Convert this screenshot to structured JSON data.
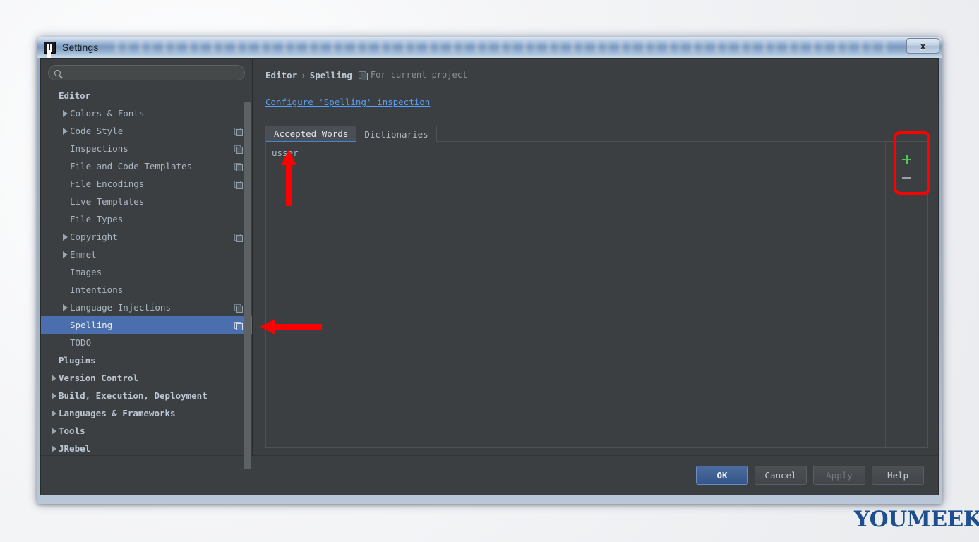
{
  "window": {
    "title": "Settings",
    "app_icon": "intellij-idea-logo-icon",
    "close_label": "x"
  },
  "sidebar": {
    "search": {
      "value": "",
      "placeholder": "",
      "icon": "search-icon"
    },
    "items": [
      {
        "label": "Editor",
        "indent": 0,
        "expandable": false,
        "bold": true,
        "config": false,
        "selected": false
      },
      {
        "label": "Colors & Fonts",
        "indent": 1,
        "expandable": true,
        "bold": false,
        "config": false,
        "selected": false
      },
      {
        "label": "Code Style",
        "indent": 1,
        "expandable": true,
        "bold": false,
        "config": true,
        "selected": false
      },
      {
        "label": "Inspections",
        "indent": 1,
        "expandable": false,
        "bold": false,
        "config": true,
        "selected": false
      },
      {
        "label": "File and Code Templates",
        "indent": 1,
        "expandable": false,
        "bold": false,
        "config": true,
        "selected": false
      },
      {
        "label": "File Encodings",
        "indent": 1,
        "expandable": false,
        "bold": false,
        "config": true,
        "selected": false
      },
      {
        "label": "Live Templates",
        "indent": 1,
        "expandable": false,
        "bold": false,
        "config": false,
        "selected": false
      },
      {
        "label": "File Types",
        "indent": 1,
        "expandable": false,
        "bold": false,
        "config": false,
        "selected": false
      },
      {
        "label": "Copyright",
        "indent": 1,
        "expandable": true,
        "bold": false,
        "config": true,
        "selected": false
      },
      {
        "label": "Emmet",
        "indent": 1,
        "expandable": true,
        "bold": false,
        "config": false,
        "selected": false
      },
      {
        "label": "Images",
        "indent": 1,
        "expandable": false,
        "bold": false,
        "config": false,
        "selected": false
      },
      {
        "label": "Intentions",
        "indent": 1,
        "expandable": false,
        "bold": false,
        "config": false,
        "selected": false
      },
      {
        "label": "Language Injections",
        "indent": 1,
        "expandable": true,
        "bold": false,
        "config": true,
        "selected": false
      },
      {
        "label": "Spelling",
        "indent": 1,
        "expandable": false,
        "bold": false,
        "config": true,
        "selected": true
      },
      {
        "label": "TODO",
        "indent": 1,
        "expandable": false,
        "bold": false,
        "config": false,
        "selected": false
      },
      {
        "label": "Plugins",
        "indent": 0,
        "expandable": false,
        "bold": true,
        "config": false,
        "selected": false
      },
      {
        "label": "Version Control",
        "indent": 0,
        "expandable": true,
        "bold": true,
        "config": false,
        "selected": false
      },
      {
        "label": "Build, Execution, Deployment",
        "indent": 0,
        "expandable": true,
        "bold": true,
        "config": false,
        "selected": false
      },
      {
        "label": "Languages & Frameworks",
        "indent": 0,
        "expandable": true,
        "bold": true,
        "config": false,
        "selected": false
      },
      {
        "label": "Tools",
        "indent": 0,
        "expandable": true,
        "bold": true,
        "config": false,
        "selected": false
      },
      {
        "label": "JRebel",
        "indent": 0,
        "expandable": true,
        "bold": true,
        "config": false,
        "selected": false
      }
    ]
  },
  "content": {
    "breadcrumb": {
      "root": "Editor",
      "separator": "›",
      "leaf": "Spelling"
    },
    "scope_icon": "project-scope-icon",
    "scope_note": "For current project",
    "inspection_link": "Configure 'Spelling' inspection",
    "tabs": [
      {
        "label": "Accepted Words",
        "active": true
      },
      {
        "label": "Dictionaries",
        "active": false
      }
    ],
    "accepted_words": [
      "usser"
    ],
    "toolbar": [
      {
        "name": "add-word-button",
        "glyph": "plus-icon",
        "label": "+"
      },
      {
        "name": "remove-word-button",
        "glyph": "minus-icon",
        "label": "−"
      }
    ]
  },
  "footer": {
    "buttons": [
      {
        "label": "OK",
        "style": "default"
      },
      {
        "label": "Cancel",
        "style": "normal"
      },
      {
        "label": "Apply",
        "style": "disabled"
      },
      {
        "label": "Help",
        "style": "normal"
      }
    ]
  },
  "annotations": {
    "color": "#ff0000",
    "highlight_rect": "add-remove-buttons-highlight",
    "arrow_up": "points-to-accepted-word",
    "arrow_left": "points-to-spelling-item"
  },
  "watermark": {
    "text": "YOUMEEK",
    "color": "#1d4e8f",
    "mark": "chevron-mark-icon"
  }
}
